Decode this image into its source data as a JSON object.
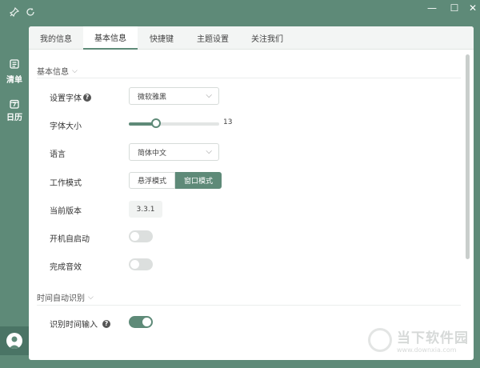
{
  "titlebar": {
    "pin_icon": "pin-icon",
    "refresh_icon": "refresh-icon",
    "minimize": "—",
    "maximize": "☐",
    "close": "✕"
  },
  "sidebar": {
    "items": [
      {
        "label": "清单",
        "icon": "list-icon"
      },
      {
        "label": "日历",
        "icon": "calendar-icon"
      }
    ],
    "calendar_day": "7"
  },
  "tabs": [
    {
      "label": "我的信息",
      "active": false
    },
    {
      "label": "基本信息",
      "active": true
    },
    {
      "label": "快捷键",
      "active": false
    },
    {
      "label": "主题设置",
      "active": false
    },
    {
      "label": "关注我们",
      "active": false
    }
  ],
  "basic": {
    "section_title": "基本信息",
    "font_label": "设置字体",
    "font_value": "微软雅黑",
    "size_label": "字体大小",
    "size_value": "13",
    "size_fraction": 0.3,
    "language_label": "语言",
    "language_value": "简体中文",
    "mode_label": "工作模式",
    "mode_float": "悬浮模式",
    "mode_window": "窗口模式",
    "mode_selected": "窗口模式",
    "version_label": "当前版本",
    "version_value": "3.3.1",
    "autostart_label": "开机自启动",
    "autostart_on": false,
    "sound_label": "完成音效",
    "sound_on": false
  },
  "time": {
    "section_title": "时间自动识别",
    "input_label": "识别时间输入",
    "input_on": true
  },
  "watermark": {
    "brand": "当下软件园",
    "url": "www.downxia.com"
  },
  "colors": {
    "accent": "#5e8a78",
    "background": "#ffffff"
  }
}
